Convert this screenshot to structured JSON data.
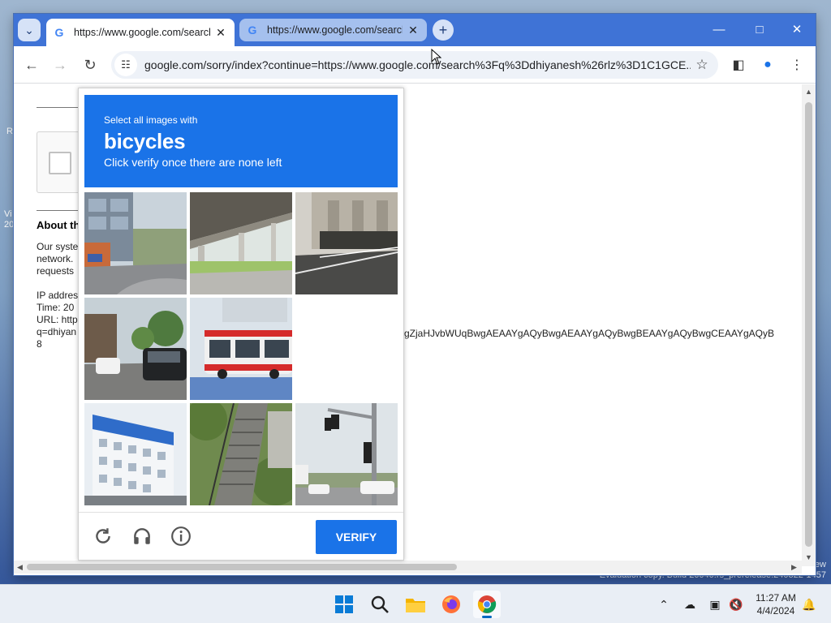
{
  "desktop": {
    "frag_r": "R",
    "frag_v": "Vi",
    "frag_20": "20",
    "eval_line1": "ew",
    "eval_line2": "Evaluation copy. Build 26040.rs_prerelease.240322-1457"
  },
  "browser": {
    "tabs": [
      {
        "title": "https://www.google.com/search",
        "active": true
      },
      {
        "title": "https://www.google.com/search",
        "active": false
      }
    ],
    "url": "google.com/sorry/index?continue=https://www.google.com/search%3Fq%3Ddhiyanesh%26rlz%3D1C1GCE...",
    "icons": {
      "tab_menu": "chevron-down-icon",
      "close_tab": "close-icon",
      "new_tab": "plus-icon",
      "back": "back-arrow-icon",
      "forward": "forward-arrow-icon",
      "reload": "reload-icon",
      "site_info": "site-info-icon",
      "bookmark": "star-icon",
      "side_panel": "side-panel-icon",
      "profile": "profile-icon",
      "menu": "more-vert-icon"
    }
  },
  "page": {
    "about_title": "About th",
    "body_line1": "Our syste",
    "body_line2": "network.",
    "body_line3": "requests",
    "ip_line": "IP addres",
    "time_line": "Time: 20",
    "url_line": "URL: http",
    "q_line": "q=dhiyan",
    "num_line": "8",
    "long_url_tail": "gZjaHJvbWUqBwgAEAAYgAQyBwgAEAAYgAQyBwgBEAAYgAQyBwgCEAAYgAQyB"
  },
  "captcha": {
    "instruction_small": "Select all images with",
    "target": "bicycles",
    "instruction_sub": "Click verify once there are none left",
    "verify_label": "VERIFY",
    "header_color": "#1a73e8",
    "tiles": [
      {
        "index": 0,
        "depicts": "building with shop on street corner"
      },
      {
        "index": 1,
        "depicts": "highway overpass"
      },
      {
        "index": 2,
        "depicts": "building with fence and sidewalk"
      },
      {
        "index": 3,
        "depicts": "street with cars and trees"
      },
      {
        "index": 4,
        "depicts": "red and white bus"
      },
      {
        "index": 5,
        "depicts": "blank loading tile"
      },
      {
        "index": 6,
        "depicts": "white and blue building"
      },
      {
        "index": 7,
        "depicts": "stairs with greenery"
      },
      {
        "index": 8,
        "depicts": "traffic lights at intersection"
      }
    ]
  },
  "taskbar": {
    "apps": [
      "windows-start-icon",
      "search-icon",
      "file-explorer-icon",
      "firefox-icon",
      "chrome-icon"
    ],
    "time": "11:27 AM",
    "date": "4/4/2024"
  }
}
